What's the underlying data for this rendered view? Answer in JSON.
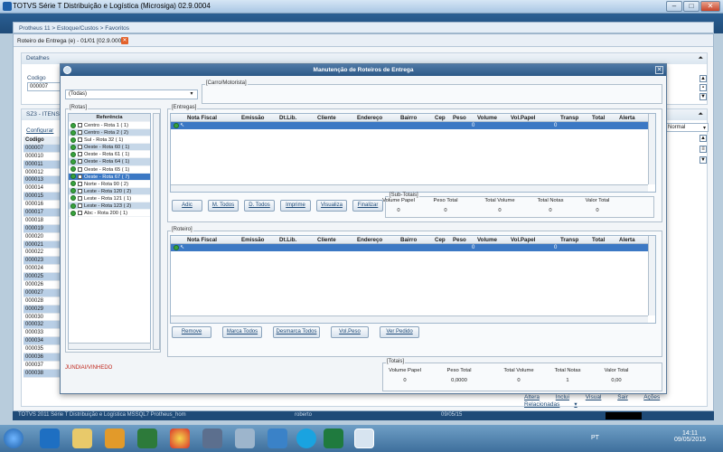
{
  "window": {
    "title": "TOTVS Série T Distribuição e Logística (Microsiga) 02.9.0004"
  },
  "breadcrumb": "Protheus 11 > Estoque/Custos > Favoritos",
  "tab": {
    "label": "Roteiro de Entrega (e) - 01/01 [02.9.0004]",
    "close": "✕"
  },
  "detalhes": {
    "title": "Detalhes",
    "codigo_label": "Codigo",
    "codigo_value": "000007"
  },
  "sz3": {
    "title": "SZ3 - ITENS T",
    "configurar": "Configurar",
    "col_header": "Codigo",
    "codes": [
      "000007",
      "000010",
      "000011",
      "000012",
      "000013",
      "000014",
      "000015",
      "000016",
      "000017",
      "000018",
      "000019",
      "000020",
      "000021",
      "000022",
      "000023",
      "000024",
      "000025",
      "000026",
      "000027",
      "000028",
      "000029",
      "000030",
      "000032",
      "000033",
      "000034",
      "000035",
      "000036",
      "000037",
      "000038"
    ],
    "normal_select": "Normal"
  },
  "bottom_links": [
    "Altera",
    "Inclui",
    "Visual",
    "Sair",
    "Ações Relacionadas"
  ],
  "statusbar": {
    "left": "TOTVS 2011 Série T Distribuição e Logística MSSQL7 Protheus_hom",
    "user": "roberto",
    "date": "09/05/15"
  },
  "modal": {
    "title": "Manutenção de Roteiros de Entrega",
    "filter": "(Todas)",
    "carro_legend": "[Carro/Motorista]",
    "rotas_legend": "[Rotas]",
    "ref_header": "Referência",
    "rotas": [
      "Centro - Rota 1 (  1)",
      "Centro - Rota 2 (  2)",
      "Sul - Rota 32 (  1)",
      "Oeste - Rota 60 (  1)",
      "Oeste - Rota 61 (  1)",
      "Oeste - Rota 64 (  1)",
      "Oeste - Rota 65 (  1)",
      "Oeste - Rota 67 (  7)",
      "Norte - Rota 90 (  2)",
      "Leste - Rota 120 (  2)",
      "Leste - Rota 121 (  1)",
      "Leste - Rota 123 (  2)",
      "Abc - Rota 200 (  1)"
    ],
    "juncao": "JUNDIAI/VINHEDO",
    "entregas_legend": "[Entregas]",
    "roteiro_legend": "[Roteiro]",
    "columns": [
      "Nota Fiscal",
      "Emissão",
      "Dt.Lib.",
      "Cliente",
      "Endereço",
      "Bairro",
      "Cep",
      "Peso",
      "Volume",
      "Vol.Papel",
      "Transp",
      "Total",
      "Alerta"
    ],
    "row_values": {
      "volume": "0",
      "volpapel": "0"
    },
    "entregas_buttons": [
      "Adic",
      "M. Todos",
      "D. Todos",
      "Imprime",
      "Visualiza",
      "Finalizar"
    ],
    "roteiro_buttons": [
      "Remove",
      "Marca Todos",
      "Desmarca Todos",
      "Vol.Peso",
      "Ver Pedido"
    ],
    "subtotais": {
      "legend": "[Sub-Totais]",
      "headers": [
        "Volume Papel",
        "Peso Total",
        "Total Volume",
        "Total Notas",
        "Valor Total"
      ],
      "values": [
        "0",
        "0",
        "0",
        "0",
        "0"
      ]
    },
    "totais": {
      "legend": "[Totais]",
      "headers": [
        "Volume Papel",
        "Peso Total",
        "Total Volume",
        "Total Notas",
        "Valor Total"
      ],
      "values": [
        "0",
        "0,0000",
        "0",
        "1",
        "0,00"
      ]
    }
  },
  "taskbar": {
    "lang": "PT",
    "time": "14:11",
    "date": "09/05/2015"
  }
}
